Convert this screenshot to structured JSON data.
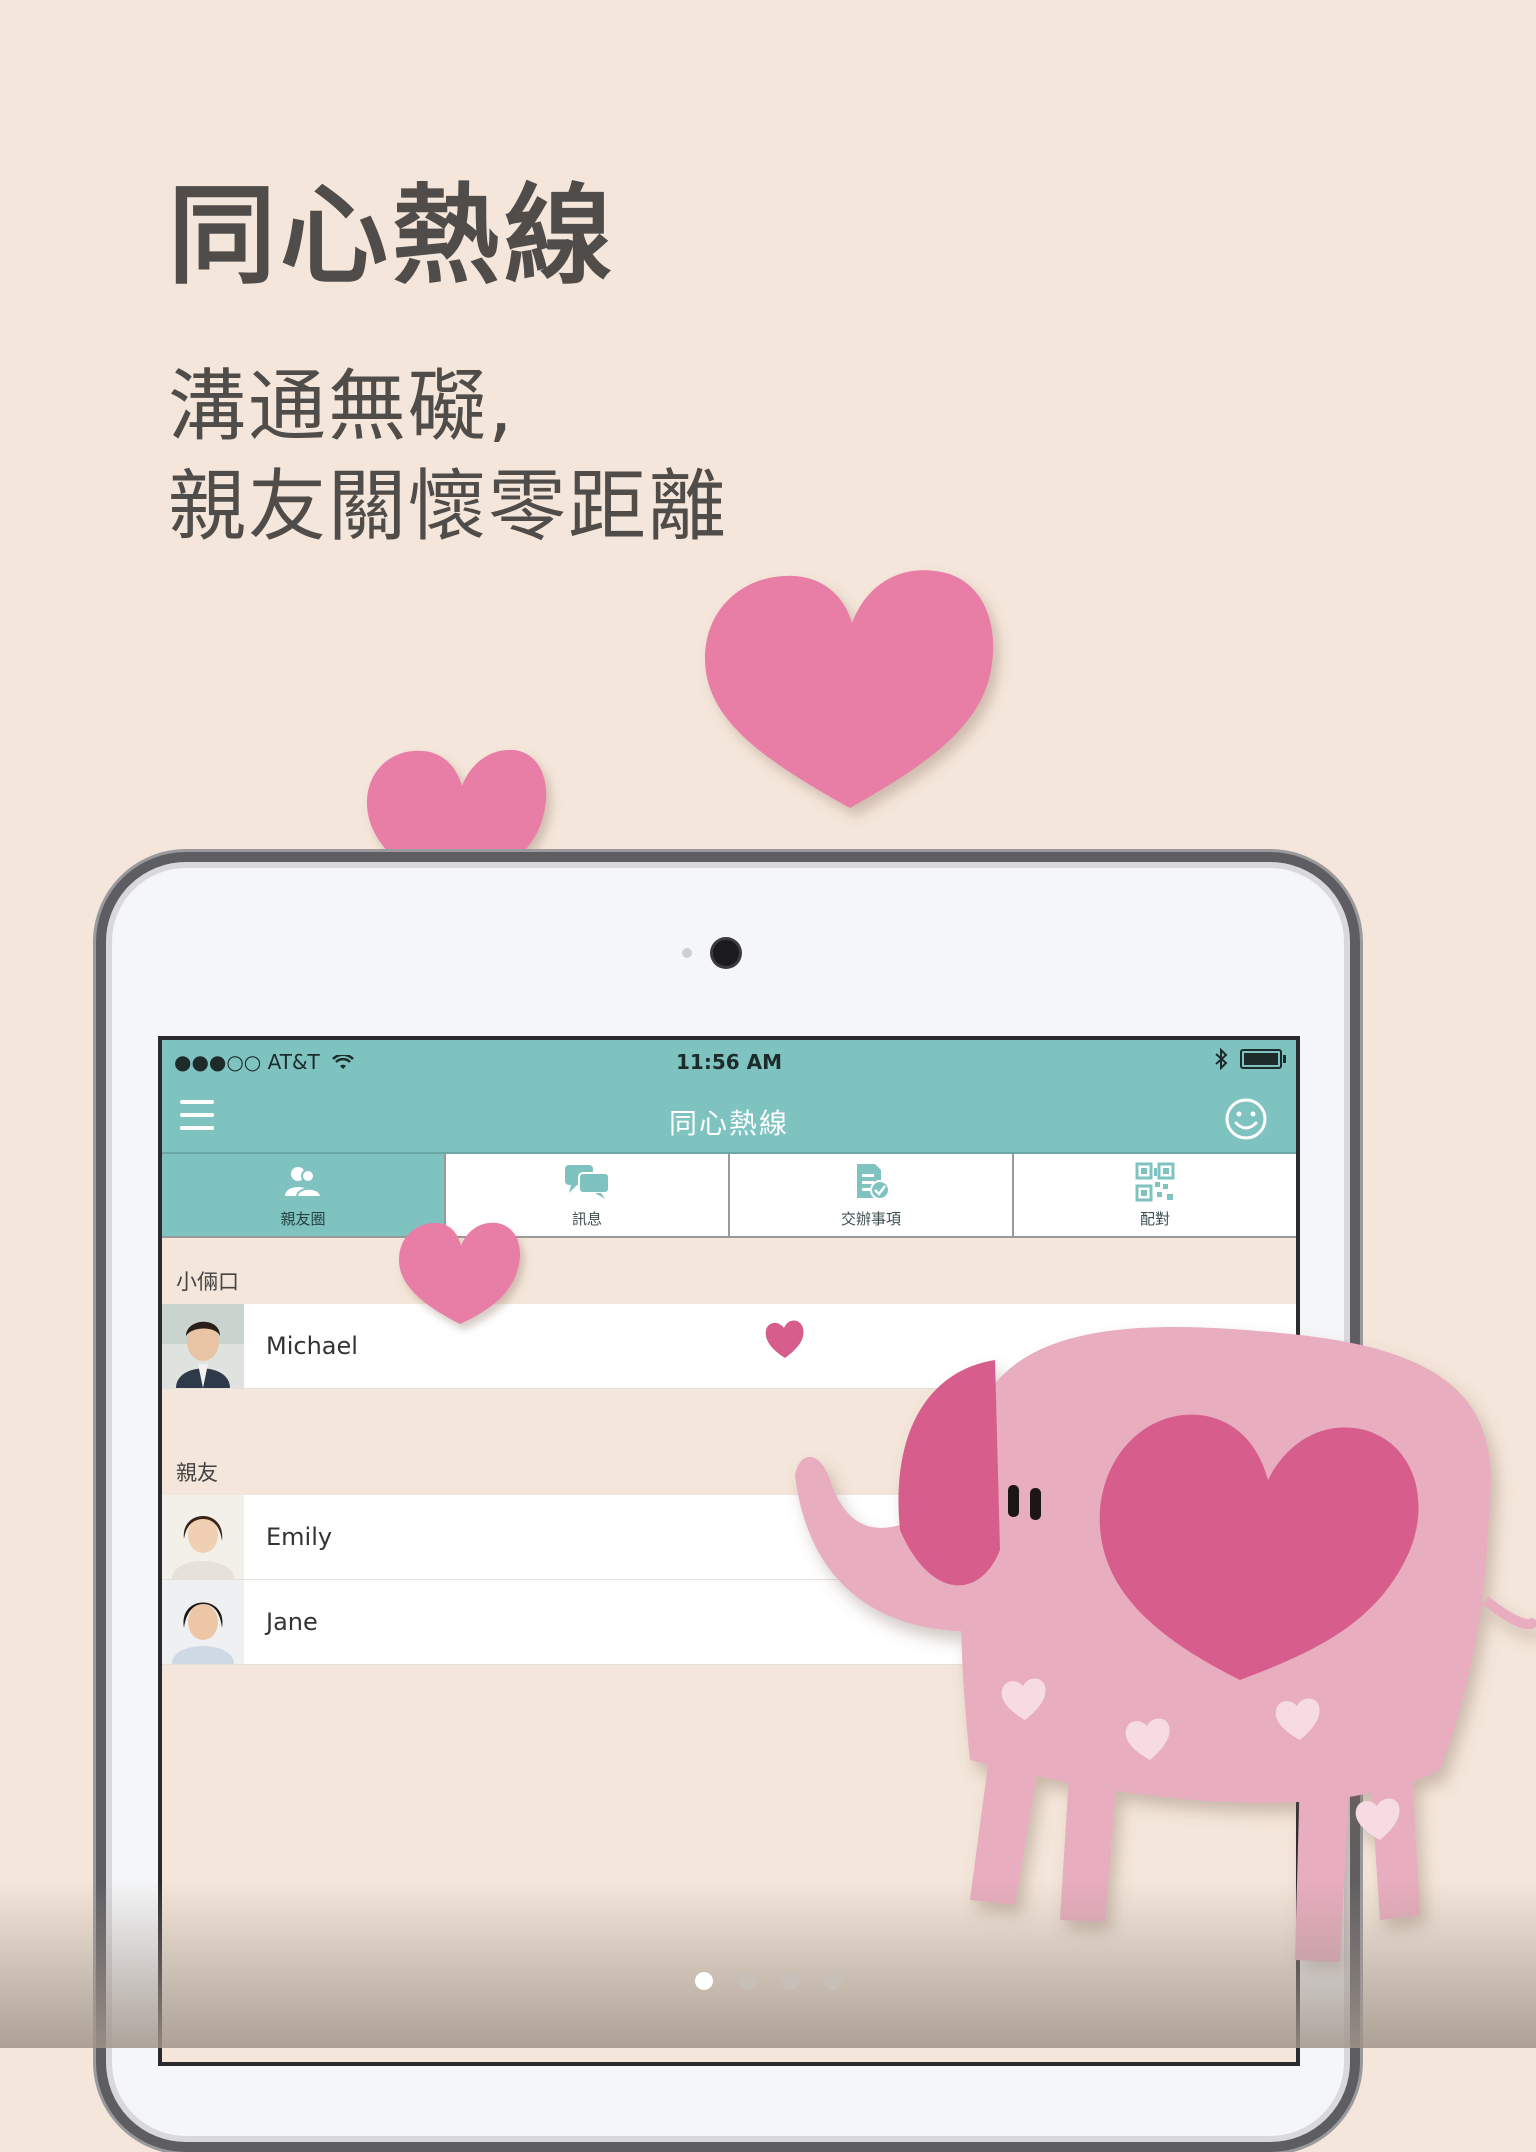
{
  "headline": {
    "title": "同心熱線",
    "subtitle_line1": "溝通無礙,",
    "subtitle_line2": "親友關懷零距離"
  },
  "status_bar": {
    "carrier": "●●●○○ AT&T",
    "time": "11:56 AM"
  },
  "nav": {
    "title": "同心熱線"
  },
  "tabs": [
    {
      "label": "親友圈",
      "icon": "contacts-icon",
      "active": true
    },
    {
      "label": "訊息",
      "icon": "chat-bubbles-icon",
      "active": false
    },
    {
      "label": "交辦事項",
      "icon": "task-check-icon",
      "active": false
    },
    {
      "label": "配對",
      "icon": "qr-code-icon",
      "active": false
    }
  ],
  "sections": [
    {
      "title": "小倆口",
      "people": [
        {
          "name": "Michael"
        }
      ]
    },
    {
      "title": "親友",
      "people": [
        {
          "name": "Emily"
        },
        {
          "name": "Jane"
        }
      ]
    }
  ],
  "pager": {
    "total": 4,
    "current": 0
  },
  "colors": {
    "background": "#f4e6da",
    "accent_teal": "#7fc3c0",
    "heart_pink": "#e87da6",
    "elephant_pink": "#e8adbe",
    "elephant_dark_pink": "#d65d8c"
  }
}
